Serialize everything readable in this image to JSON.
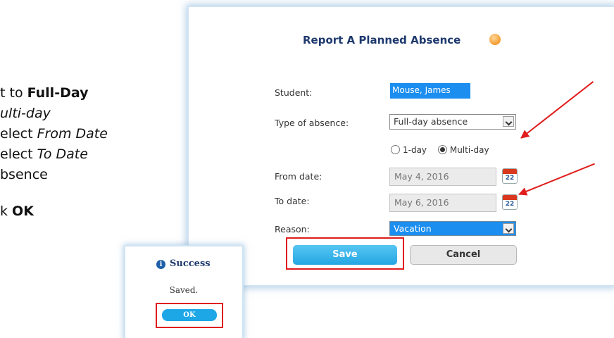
{
  "instructions": {
    "line1_prefix": "t to ",
    "line1_bold": "Full-Day",
    "line2_italic": "ulti-day",
    "line3_prefix": "elect ",
    "line3_italic": "From Date",
    "line4_prefix": "elect ",
    "line4_italic": "To Date",
    "line5": "bsence",
    "line6_prefix": "k ",
    "line6_bold": "OK"
  },
  "dialog": {
    "title": "Report A Planned Absence",
    "help_icon": "help-icon",
    "student_label": "Student:",
    "student_value": "Mouse, James",
    "type_label": "Type of absence:",
    "type_value": "Full-day absence",
    "radio_one_day": "1-day",
    "radio_multi_day": "Multi-day",
    "selected_radio": "Multi-day",
    "from_label": "From date:",
    "from_value": "May 4, 2016",
    "to_label": "To date:",
    "to_value": "May 6, 2016",
    "calendar_day": "22",
    "reason_label": "Reason:",
    "reason_value": "Vacation",
    "save_label": "Save",
    "cancel_label": "Cancel"
  },
  "popup": {
    "title": "Success",
    "message": "Saved.",
    "ok_label": "OK"
  },
  "colors": {
    "accent": "#1b8ef0",
    "annotation": "#e01c1c",
    "title": "#1e3a6e"
  }
}
